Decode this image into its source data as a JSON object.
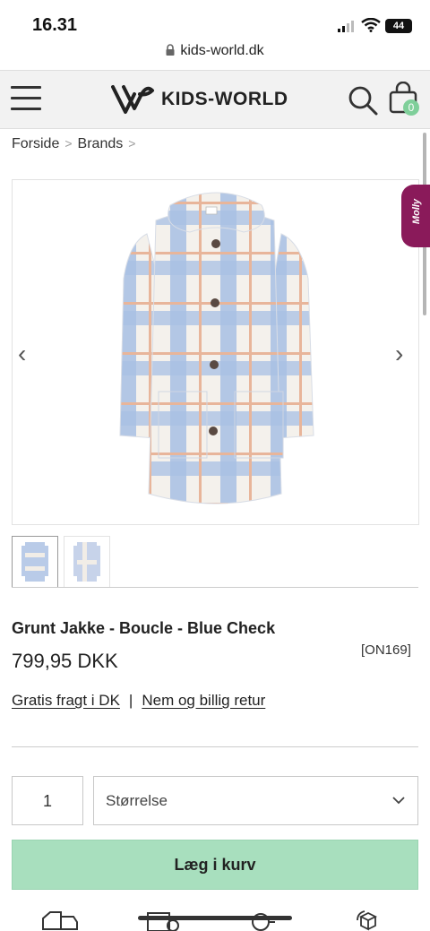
{
  "status_bar": {
    "time": "16.31",
    "battery": "44"
  },
  "browser": {
    "url": "kids-world.dk"
  },
  "header": {
    "brand": "KIDS-WORLD",
    "cart_count": "0"
  },
  "breadcrumb": {
    "items": [
      "Forside",
      "Brands"
    ]
  },
  "gallery": {
    "chat_widget_label": "Molly",
    "thumbnail_count": 2
  },
  "product": {
    "title": "Grunt Jakke - Boucle - Blue Check",
    "price": "799,95 DKK",
    "sku": "[ON169]",
    "shipping_link": "Gratis fragt i DK",
    "separator": "|",
    "return_link": "Nem og billig retur"
  },
  "purchase": {
    "quantity": "1",
    "size_placeholder": "Størrelse",
    "add_to_cart": "Læg i kurv"
  },
  "colors": {
    "header_bg": "#f2f2f2",
    "add_to_cart_bg": "#a8dfbe",
    "cart_badge": "#7fcf9a",
    "chat_widget": "#8a1a5a",
    "check_blue": "#a8c0e4",
    "check_peach": "#e8b59a"
  }
}
